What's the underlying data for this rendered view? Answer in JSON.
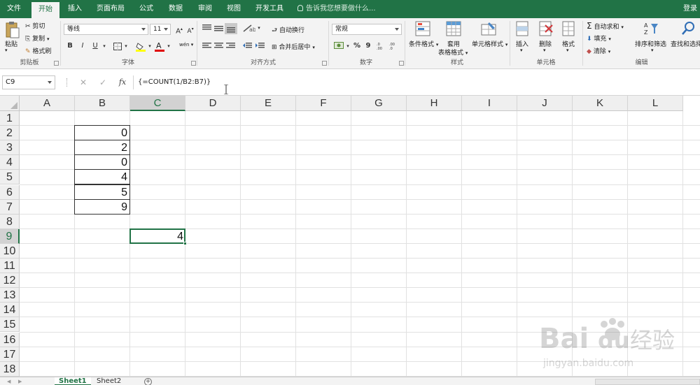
{
  "ribbon_tabs": [
    "文件",
    "开始",
    "插入",
    "页面布局",
    "公式",
    "数据",
    "审阅",
    "视图",
    "开发工具"
  ],
  "active_tab": "开始",
  "tell_me": "告诉我您想要做什么...",
  "login": "登录",
  "clipboard": {
    "paste": "粘贴",
    "cut": "剪切",
    "copy": "复制",
    "format_painter": "格式刷",
    "label": "剪贴板"
  },
  "font": {
    "name": "等线",
    "size": "11",
    "grow": "A",
    "shrink": "A",
    "bold": "B",
    "italic": "I",
    "underline": "U",
    "label": "字体",
    "phonetic": "wén"
  },
  "alignment": {
    "wrap": "自动换行",
    "merge": "合并后居中",
    "label": "对齐方式"
  },
  "number": {
    "format": "常规",
    "percent": "%",
    "comma": "9",
    "label": "数字"
  },
  "styles": {
    "conditional": "条件格式",
    "table_line1": "套用",
    "table_line2": "表格格式",
    "cell_styles": "单元格样式",
    "label": "样式"
  },
  "cells": {
    "insert": "插入",
    "delete": "删除",
    "format": "格式",
    "label": "单元格"
  },
  "editing": {
    "autosum": "自动求和",
    "fill": "填充",
    "clear": "清除",
    "sort": "排序和筛选",
    "find": "查找和选择",
    "label": "编辑"
  },
  "formula_bar": {
    "name_box": "C9",
    "cancel": "✕",
    "enter": "✓",
    "fx": "fx",
    "formula": "{=COUNT(1/B2:B7)}"
  },
  "columns": [
    "A",
    "B",
    "C",
    "D",
    "E",
    "F",
    "G",
    "H",
    "I",
    "J",
    "K",
    "L"
  ],
  "selected_column": "C",
  "rows": [
    "1",
    "2",
    "3",
    "4",
    "5",
    "6",
    "7",
    "8",
    "9",
    "10",
    "11",
    "12",
    "13",
    "14",
    "15",
    "16",
    "17",
    "18"
  ],
  "selected_row": "9",
  "cells_data": {
    "B2": "0",
    "B3": "2",
    "B4": "0",
    "B5": "4",
    "B6": "5",
    "B7": "9",
    "C9": "4"
  },
  "sheets": [
    "Sheet1",
    "Sheet2"
  ],
  "active_sheet": "Sheet1",
  "watermark": {
    "brand": "Bai",
    "brand_suffix": "du",
    "product": "经验",
    "url": "jingyan.baidu.com"
  },
  "colors": {
    "accent": "#217346",
    "grid": "#e1e1e1"
  }
}
